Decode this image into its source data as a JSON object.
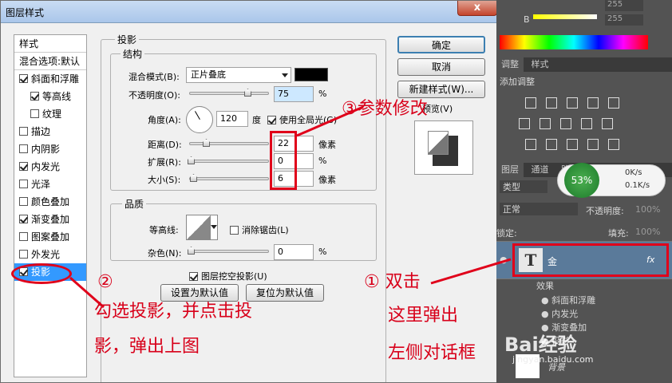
{
  "dialog": {
    "title": "图层样式",
    "close_label": "x"
  },
  "left_panel": {
    "header": "样式",
    "blend_default": "混合选项:默认",
    "items": [
      {
        "label": "斜面和浮雕",
        "checked": true,
        "indent": false
      },
      {
        "label": "等高线",
        "checked": true,
        "indent": true
      },
      {
        "label": "纹理",
        "checked": false,
        "indent": true
      },
      {
        "label": "描边",
        "checked": false,
        "indent": false
      },
      {
        "label": "内阴影",
        "checked": false,
        "indent": false
      },
      {
        "label": "内发光",
        "checked": true,
        "indent": false
      },
      {
        "label": "光泽",
        "checked": false,
        "indent": false
      },
      {
        "label": "颜色叠加",
        "checked": false,
        "indent": false
      },
      {
        "label": "渐变叠加",
        "checked": true,
        "indent": false
      },
      {
        "label": "图案叠加",
        "checked": false,
        "indent": false
      },
      {
        "label": "外发光",
        "checked": false,
        "indent": false
      },
      {
        "label": "投影",
        "checked": true,
        "indent": false,
        "selected": true
      }
    ]
  },
  "shadow": {
    "group_title": "投影",
    "structure_title": "结构",
    "blend_mode_label": "混合模式(B):",
    "blend_mode_value": "正片叠底",
    "opacity_label": "不透明度(O):",
    "opacity_value": "75",
    "opacity_unit": "%",
    "angle_label": "角度(A):",
    "angle_value": "120",
    "angle_unit": "度",
    "global_light_label": "使用全局光(G)",
    "distance_label": "距离(D):",
    "distance_value": "22",
    "distance_unit": "像素",
    "spread_label": "扩展(R):",
    "spread_value": "0",
    "spread_unit": "%",
    "size_label": "大小(S):",
    "size_value": "6",
    "size_unit": "像素",
    "quality_title": "品质",
    "contour_label": "等高线:",
    "antialias_label": "消除锯齿(L)",
    "noise_label": "杂色(N):",
    "noise_value": "0",
    "noise_unit": "%",
    "knockout_label": "图层挖空投影(U)",
    "set_default_label": "设置为默认值",
    "reset_default_label": "复位为默认值"
  },
  "buttons": {
    "ok": "确定",
    "cancel": "取消",
    "new_style": "新建样式(W)...",
    "preview": "预览(V)"
  },
  "annotations": {
    "step1": "① 双击",
    "step1_line2": "这里弹出",
    "step1_line3": "左侧对话框",
    "step2": "②",
    "step2_line1": "勾选投影，并点击投",
    "step2_line2": "影，弹出上图",
    "step3": "③参数修改"
  },
  "right_panel": {
    "color_label": "B",
    "color_value": "255",
    "color_value2": "255",
    "adjust_tab": "调整",
    "style_tab": "样式",
    "add_adjust": "添加调整",
    "layers_tab": "图层",
    "channels_tab": "通道",
    "paths_tab": "路",
    "type_filter": "类型",
    "blend_normal": "正常",
    "opacity_label": "不透明度:",
    "opacity_value": "100%",
    "lock_label": "锁定:",
    "fill_label": "填充:",
    "fill_value": "100%",
    "layer_name": "金",
    "layer_fx": "fx",
    "effects_label": "效果",
    "effects": [
      "斜面和浮雕",
      "内发光",
      "渐变叠加",
      "投影"
    ],
    "background_layer": "背景",
    "net_percent": "53%",
    "net_up": "0K/s",
    "net_down": "0.1K/s",
    "watermark": "Bai经验",
    "watermark_url": "jingyan.baidu.com"
  },
  "colors": {
    "accent_red": "#d8001a",
    "select_blue": "#3399ff",
    "shadow_swatch": "#000000"
  }
}
